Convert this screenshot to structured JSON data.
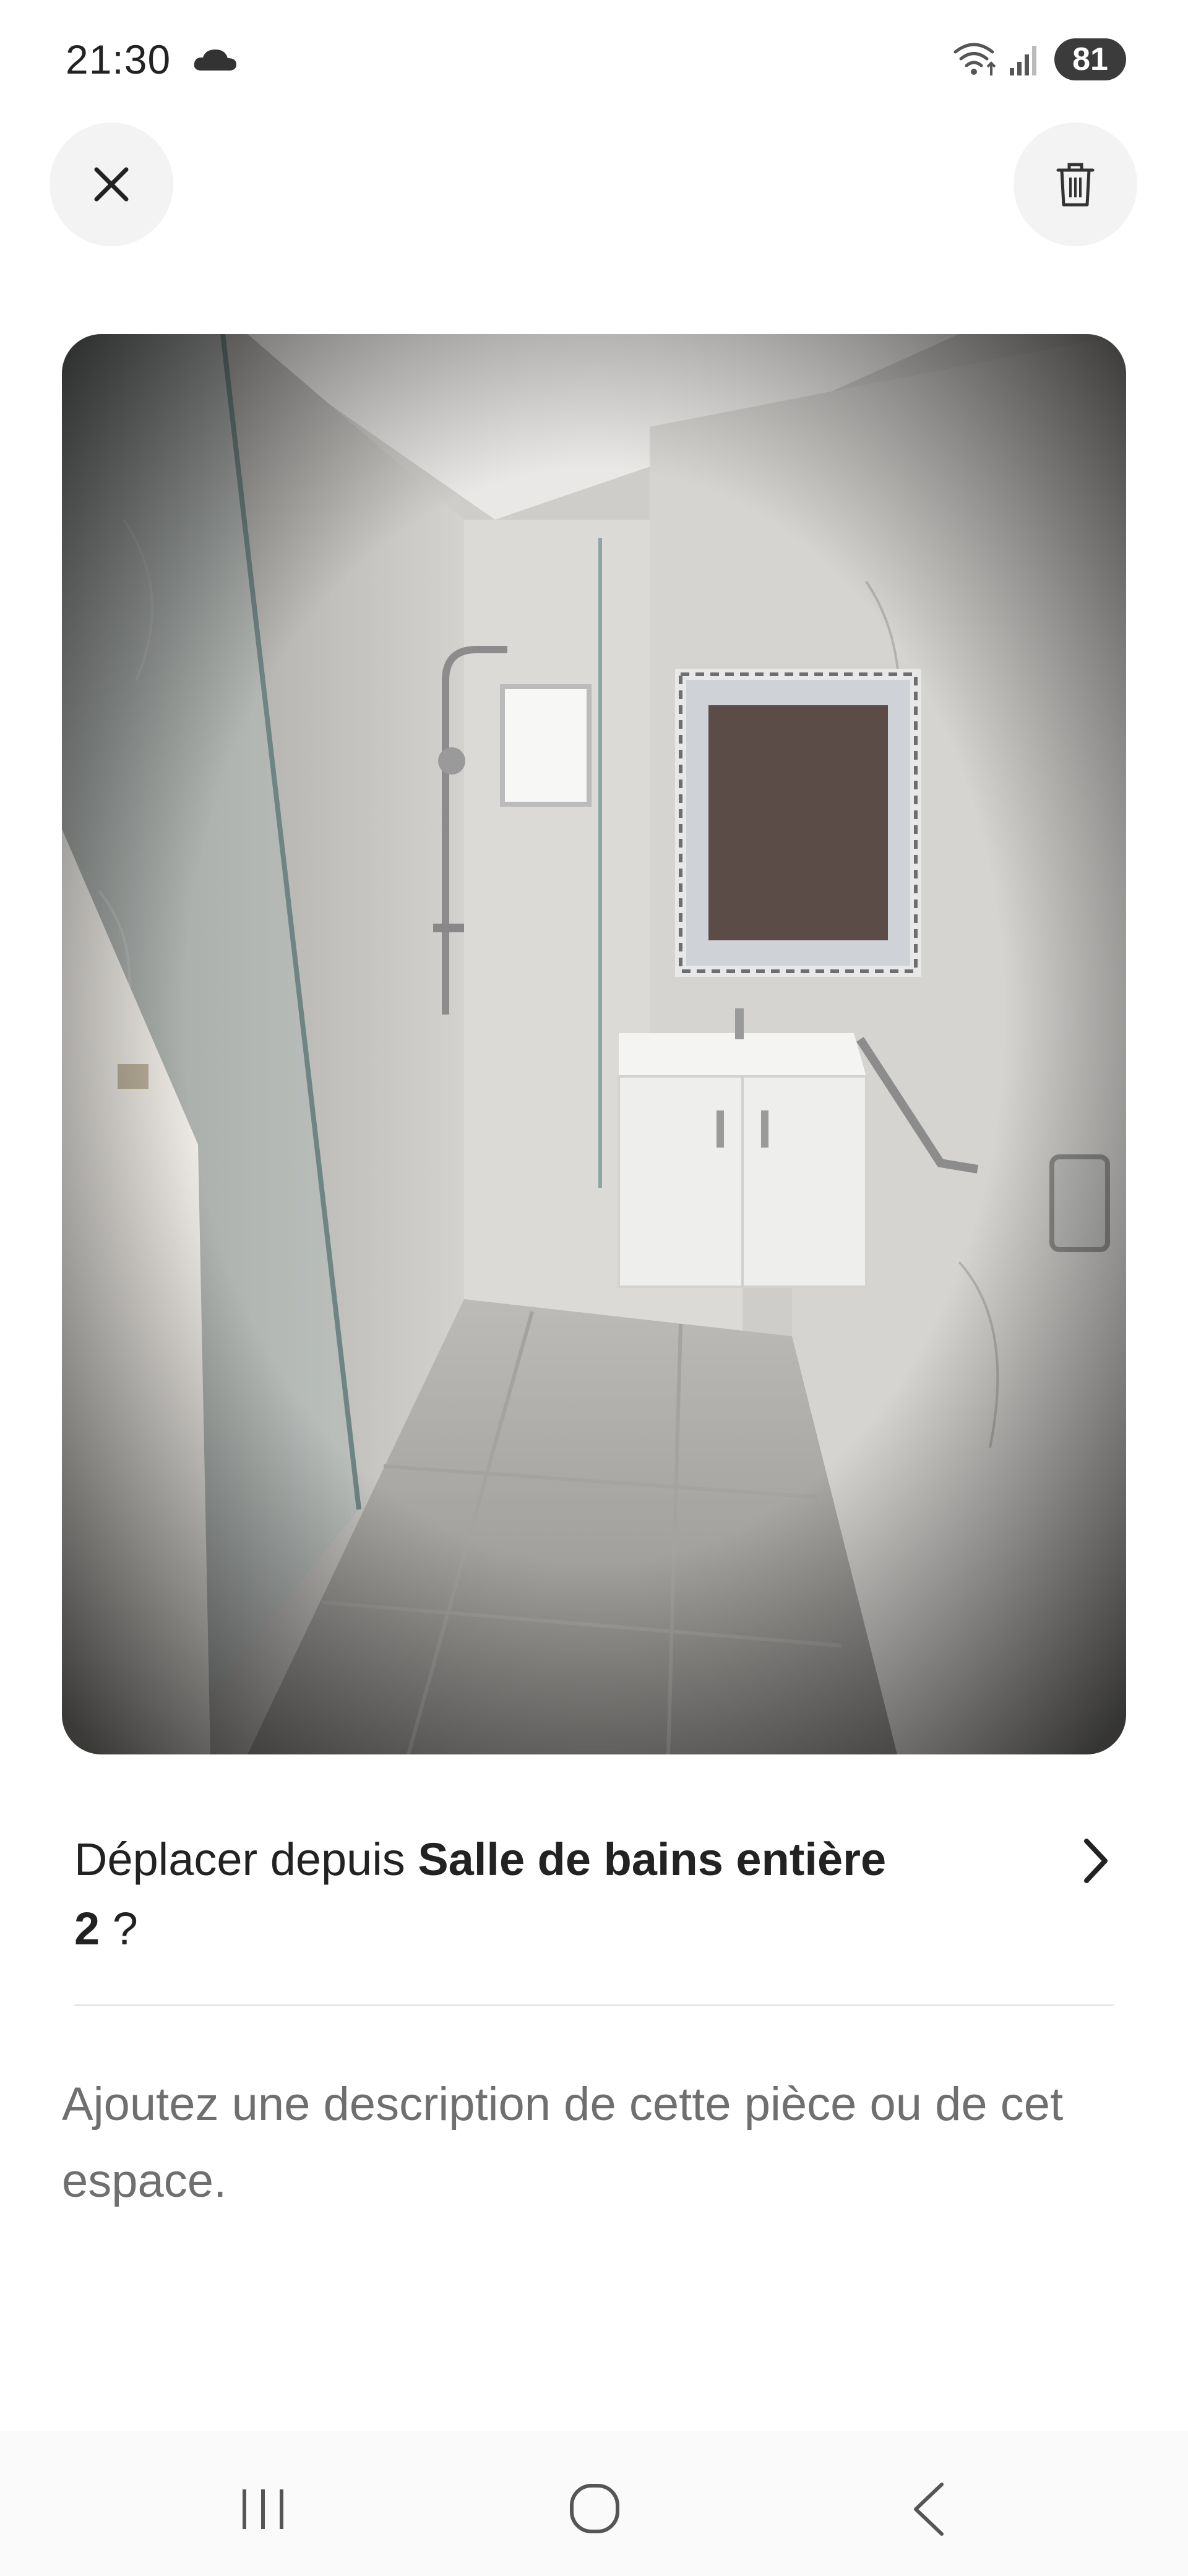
{
  "status_bar": {
    "time": "21:30",
    "battery": "81",
    "icons": [
      "cloud-icon",
      "wifi-icon",
      "signal-icon"
    ]
  },
  "top_bar": {
    "close_icon": "close-icon",
    "delete_icon": "trash-icon"
  },
  "photo": {
    "subject": "bathroom"
  },
  "move": {
    "prefix": "Déplacer depuis ",
    "room_name": "Salle de bains entière",
    "room_number": "2",
    "suffix": " ?",
    "icon": "chevron-right-icon"
  },
  "description": {
    "placeholder": "Ajoutez une description de cette pièce ou de cet espace."
  },
  "nav_bar": {
    "icons": [
      "recent-apps-icon",
      "home-icon",
      "back-icon"
    ]
  },
  "colors": {
    "background": "#ffffff",
    "button_bg": "#f3f3f3",
    "text": "#222222",
    "muted_text": "#6f6f6f",
    "divider": "#e6e6e6"
  }
}
